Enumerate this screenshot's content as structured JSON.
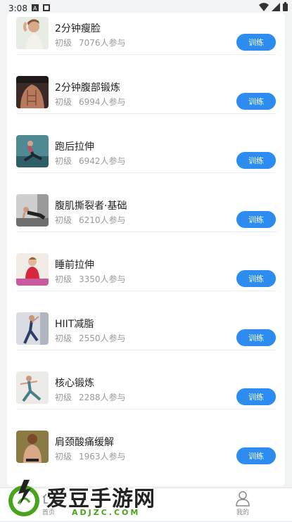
{
  "status_bar": {
    "time": "3:08"
  },
  "courses": [
    {
      "title": "2分钟瘦脸",
      "level": "初级",
      "participants": "7076人参与",
      "button": "训练"
    },
    {
      "title": "2分钟腹部锻炼",
      "level": "初级",
      "participants": "6994人参与",
      "button": "训练"
    },
    {
      "title": "跑后拉伸",
      "level": "初级",
      "participants": "6942人参与",
      "button": "训练"
    },
    {
      "title": "腹肌撕裂者·基础",
      "level": "初级",
      "participants": "6210人参与",
      "button": "训练"
    },
    {
      "title": "睡前拉伸",
      "level": "初级",
      "participants": "3350人参与",
      "button": "训练"
    },
    {
      "title": "HIIT减脂",
      "level": "初级",
      "participants": "2550人参与",
      "button": "训练"
    },
    {
      "title": "核心锻炼",
      "level": "初级",
      "participants": "2288人参与",
      "button": "训练"
    },
    {
      "title": "肩颈酸痛缓解",
      "level": "初级",
      "participants": "1963人参与",
      "button": "训练"
    }
  ],
  "tabbar": {
    "home": "首页",
    "me": "我的"
  },
  "watermark": {
    "name": "爱豆手游网",
    "url": "ADJZC.COM"
  },
  "colors": {
    "accent": "#2c8cf0",
    "watermark_green": "#4aa31c"
  }
}
